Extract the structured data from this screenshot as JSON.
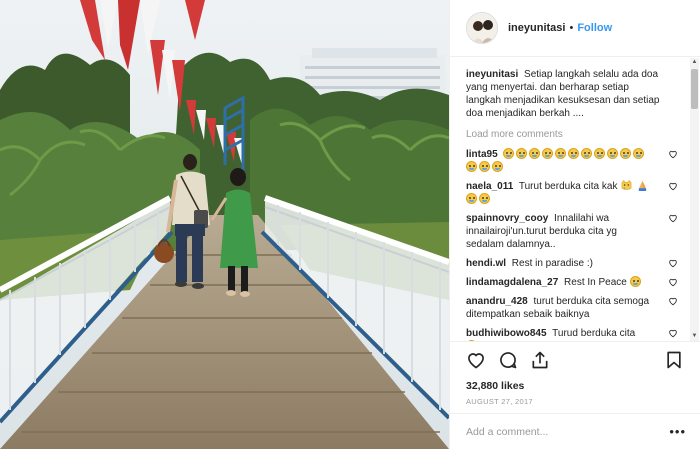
{
  "post": {
    "author": "ineyunitasi",
    "follow_label": "Follow",
    "separator": "•",
    "caption_user": "ineyunitasi",
    "caption_text": "Setiap langkah selalu ada doa yang menyertai. dan berharap setiap langkah menjadikan kesuksesan dan setiap doa menjadikan berkah ....",
    "load_more": "Load more comments",
    "likes": "32,880 likes",
    "date": "AUGUST 27, 2017",
    "add_comment_placeholder": "Add a comment...",
    "more_options": "•••"
  },
  "comments": [
    {
      "user": "linta95",
      "text": "",
      "emoji_count": 14
    },
    {
      "user": "naela_011",
      "text": "Turut berduka cita kak",
      "emoji_count": 2
    },
    {
      "user": "spainnovry_cooy",
      "text": "Innalilahi wa innailairoji'un.turut berduka cita yg sedalam dalamnya..",
      "emoji_count": 0
    },
    {
      "user": "hendi.wl",
      "text": "Rest in paradise :)",
      "emoji_count": 0
    },
    {
      "user": "lindamagdalena_27",
      "text": "Rest In Peace",
      "emoji_count": 1
    },
    {
      "user": "anandru_428",
      "text": "turut berduka cita semoga ditempatkan sebaik baiknya",
      "emoji_count": 0
    },
    {
      "user": "budhiwibowo845",
      "text": "Turud berduka cita",
      "emoji_count": 1
    }
  ],
  "icons": {
    "like": "heart-icon",
    "comment": "speech-bubble-icon",
    "share": "share-icon",
    "save": "bookmark-icon"
  },
  "colors": {
    "accent": "#3897f0",
    "muted": "#999999",
    "border": "#efefef"
  }
}
